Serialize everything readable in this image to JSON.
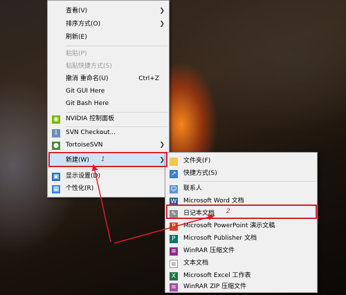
{
  "context_menu": {
    "items": [
      {
        "label": "查看(V)",
        "has_submenu": true
      },
      {
        "label": "排序方式(O)",
        "has_submenu": true
      },
      {
        "label": "刷新(E)"
      },
      {
        "label": "粘贴(P)",
        "disabled": true
      },
      {
        "label": "粘贴快捷方式(S)",
        "disabled": true
      },
      {
        "label": "撤消 重命名(U)",
        "shortcut": "Ctrl+Z"
      },
      {
        "label": "Git GUI Here"
      },
      {
        "label": "Git Bash Here"
      },
      {
        "label": "NVIDIA 控制面板"
      },
      {
        "label": "SVN Checkout..."
      },
      {
        "label": "TortoiseSVN",
        "has_submenu": true
      },
      {
        "label": "新建(W)",
        "has_submenu": true,
        "highlighted": true
      },
      {
        "label": "显示设置(D)"
      },
      {
        "label": "个性化(R)"
      }
    ]
  },
  "new_submenu": {
    "items": [
      {
        "label": "文件夹(F)",
        "icon": "folder-icon"
      },
      {
        "label": "快捷方式(S)",
        "icon": "shortcut-icon"
      },
      {
        "label": "联系人",
        "icon": "contact-icon"
      },
      {
        "label": "Microsoft Word 文档",
        "icon": "word-icon"
      },
      {
        "label": "日记本文档",
        "icon": "journal-icon",
        "highlighted": true
      },
      {
        "label": "Microsoft PowerPoint 演示文稿",
        "icon": "powerpoint-icon"
      },
      {
        "label": "Microsoft Publisher 文档",
        "icon": "publisher-icon"
      },
      {
        "label": "WinRAR 压缩文件",
        "icon": "winrar-icon"
      },
      {
        "label": "文本文档",
        "icon": "text-document-icon"
      },
      {
        "label": "Microsoft Excel 工作表",
        "icon": "excel-icon"
      },
      {
        "label": "WinRAR ZIP 压缩文件",
        "icon": "winrar-zip-icon"
      }
    ]
  },
  "annotations": {
    "marker_1": "1",
    "marker_2": "2",
    "color": "#d81e2b"
  },
  "colors": {
    "menu_bg": "#f0f0f0",
    "highlight": "#cde4f7"
  }
}
